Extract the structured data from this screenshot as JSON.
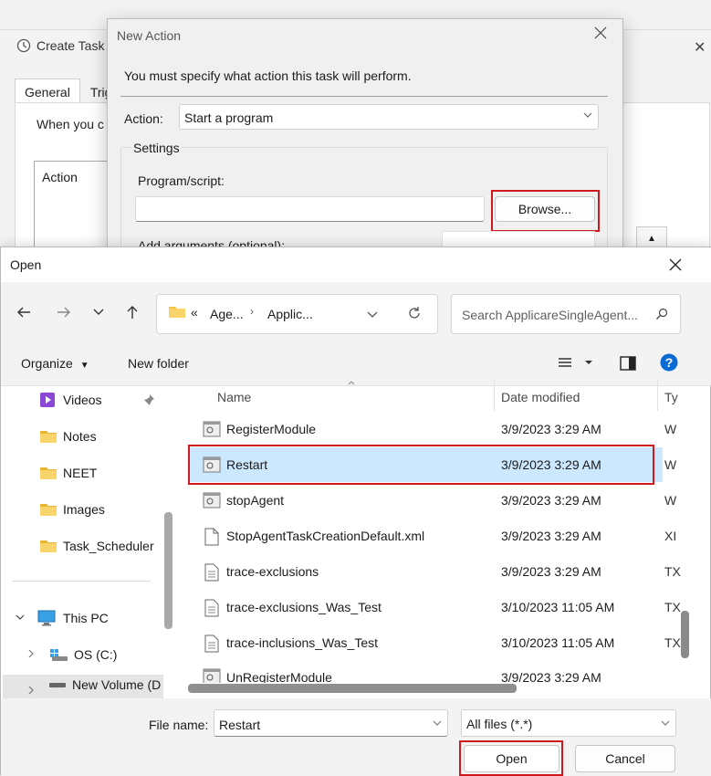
{
  "create_task": {
    "title": "Create Task",
    "tabs": [
      "General",
      "Trig"
    ],
    "description": "When you c",
    "list_header": "Action"
  },
  "new_action": {
    "title": "New Action",
    "message": "You must specify what action this task will perform.",
    "action_label": "Action:",
    "action_value": "Start a program",
    "settings_label": "Settings",
    "program_label": "Program/script:",
    "program_value": "",
    "browse_label": "Browse...",
    "args_label": "Add arguments (optional):"
  },
  "open_dialog": {
    "title": "Open",
    "breadcrumb": {
      "overflow": "«",
      "parts": [
        "Age...",
        "Applic..."
      ]
    },
    "search_placeholder": "Search ApplicareSingleAgent...",
    "toolbar": {
      "organize_label": "Organize",
      "new_folder_label": "New folder"
    },
    "sidebar": [
      {
        "label": "Videos",
        "icon": "videos-folder-icon",
        "pinned": true
      },
      {
        "label": "Notes",
        "icon": "folder-icon"
      },
      {
        "label": "NEET",
        "icon": "folder-icon"
      },
      {
        "label": "Images",
        "icon": "folder-icon"
      },
      {
        "label": "Task_Scheduler",
        "icon": "folder-icon"
      },
      {
        "label": "This PC",
        "icon": "computer-icon",
        "expanded": true
      },
      {
        "label": "OS (C:)",
        "icon": "drive-icon"
      },
      {
        "label": "New Volume (D",
        "icon": "drive-icon",
        "selected": true
      }
    ],
    "columns": [
      "Name",
      "Date modified",
      "Ty"
    ],
    "files": [
      {
        "name": "RegisterModule",
        "date": "3/9/2023 3:29 AM",
        "type": "W",
        "icon": "script-file-icon"
      },
      {
        "name": "Restart",
        "date": "3/9/2023 3:29 AM",
        "type": "W",
        "icon": "script-file-icon",
        "selected": true
      },
      {
        "name": "stopAgent",
        "date": "3/9/2023 3:29 AM",
        "type": "W",
        "icon": "script-file-icon"
      },
      {
        "name": "StopAgentTaskCreationDefault.xml",
        "date": "3/9/2023 3:29 AM",
        "type": "XI",
        "icon": "blank-file-icon"
      },
      {
        "name": "trace-exclusions",
        "date": "3/9/2023 3:29 AM",
        "type": "TX",
        "icon": "text-file-icon"
      },
      {
        "name": "trace-exclusions_Was_Test",
        "date": "3/10/2023 11:05 AM",
        "type": "TX",
        "icon": "text-file-icon"
      },
      {
        "name": "trace-inclusions_Was_Test",
        "date": "3/10/2023 11:05 AM",
        "type": "TX",
        "icon": "text-file-icon"
      },
      {
        "name": "UnRegisterModule",
        "date": "3/9/2023 3:29 AM",
        "type": "W",
        "icon": "script-file-icon"
      }
    ],
    "file_name_label": "File name:",
    "file_name_value": "Restart",
    "file_type_value": "All files (*.*)",
    "open_label": "Open",
    "cancel_label": "Cancel"
  },
  "colors": {
    "highlight": "#d0191f",
    "selection": "#cce8ff",
    "folder": "#f4c542",
    "accent": "#0067c0"
  }
}
